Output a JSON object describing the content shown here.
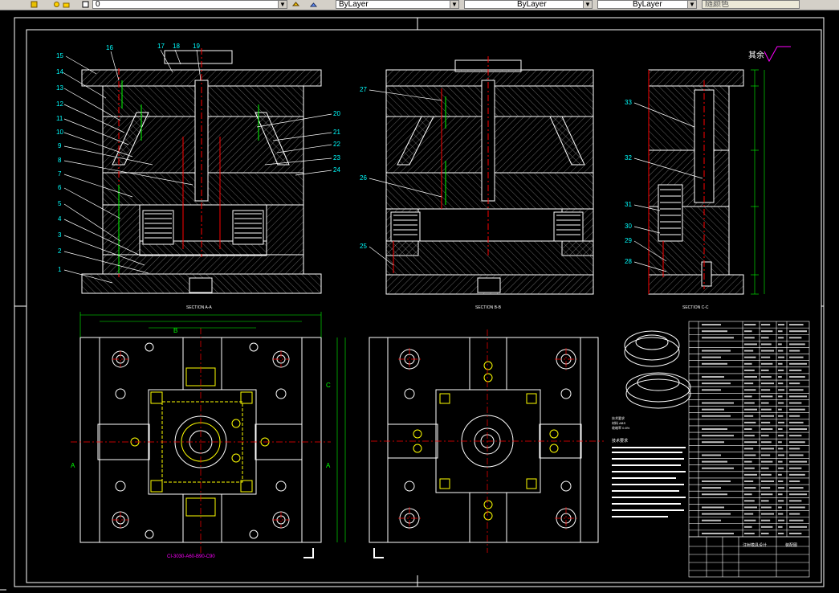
{
  "toolbar": {
    "layer_value": "0",
    "color_value": "ByLayer",
    "linetype_value": "ByLayer",
    "lineweight_value": "ByLayer",
    "plotstyle_value": "随颜色"
  },
  "drawing": {
    "section_aa": "SECTION A-A",
    "section_bb": "SECTION B-B",
    "section_cc": "SECTION C-C",
    "part_numbers_left": [
      "15",
      "14",
      "13",
      "12",
      "11",
      "10",
      "9",
      "8",
      "7",
      "6",
      "5",
      "4",
      "3",
      "2",
      "1"
    ],
    "part_numbers_top": [
      "16",
      "17",
      "18",
      "19"
    ],
    "part_numbers_right": [
      "20",
      "21",
      "22",
      "23",
      "24"
    ],
    "part_numbers_mid": [
      "27",
      "26",
      "25"
    ],
    "part_numbers_side": [
      "33",
      "32",
      "31",
      "30",
      "29",
      "28"
    ],
    "roughness_text": "其余",
    "cut_label_a": "A",
    "cut_label_b": "B",
    "cut_label_c": "C",
    "mold_base_code": "CI-3030-A60-B90-C90",
    "title_block_title": "注射模具设计",
    "title_block_name": "装配图",
    "tech_requirements_title": "技术要求"
  },
  "colors": {
    "background": "#000000",
    "white": "#ffffff",
    "cyan": "#00ffff",
    "red": "#ff0000",
    "green": "#00ff00",
    "yellow": "#ffff00",
    "magenta": "#ff00ff"
  }
}
